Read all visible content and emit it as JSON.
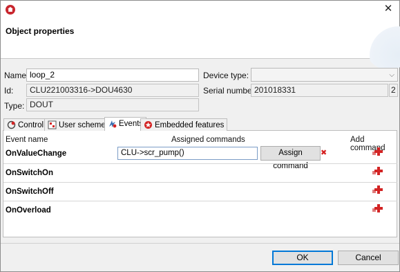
{
  "window": {
    "title": "Object properties"
  },
  "props": {
    "name_label": "Name:",
    "name_value": "loop_2",
    "id_label": "Id:",
    "id_value": "CLU221003316->DOU4630",
    "type_label": "Type:",
    "type_value": "DOUT",
    "device_type_label": "Device type:",
    "device_type_value": "",
    "serial_label": "Serial number:",
    "serial_value": "201018331",
    "serial_suffix": "2"
  },
  "tabs": [
    {
      "label": "Control",
      "icon": "control-icon"
    },
    {
      "label": "User schemes",
      "icon": "user-schemes-icon"
    },
    {
      "label": "Events",
      "icon": "events-icon",
      "active": true
    },
    {
      "label": "Embedded features",
      "icon": "embedded-features-icon"
    }
  ],
  "events": {
    "headers": {
      "event_name": "Event name",
      "assigned_commands": "Assigned commands",
      "add_command": "Add command"
    },
    "rows": [
      {
        "name": "OnValueChange",
        "command": "CLU->scr_pump()",
        "assign_label": "Assign command",
        "remove": "✖"
      },
      {
        "name": "OnSwitchOn"
      },
      {
        "name": "OnSwitchOff"
      },
      {
        "name": "OnOverload"
      }
    ]
  },
  "footer": {
    "ok": "OK",
    "cancel": "Cancel"
  },
  "colors": {
    "accent": "#0078d7",
    "danger": "#d32424",
    "brand": "#c8262e"
  }
}
